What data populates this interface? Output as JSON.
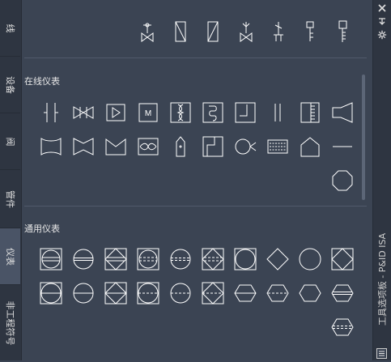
{
  "tabs": [
    {
      "id": "line",
      "label": "线"
    },
    {
      "id": "equipment",
      "label": "设备"
    },
    {
      "id": "valve",
      "label": "阀"
    },
    {
      "id": "fitting",
      "label": "管件"
    },
    {
      "id": "instrument",
      "label": "仪表",
      "active": true
    },
    {
      "id": "nonengineering",
      "label": "非工程符号"
    }
  ],
  "palette_title": "工具选项板 - P&ID ISA",
  "sections": {
    "inline": {
      "title": "在线仪表"
    },
    "general": {
      "title": "通用仪表"
    }
  },
  "colors": {
    "accent": "#ffffff",
    "background": "#3b4453",
    "strip": "#2e3541"
  },
  "icons": {
    "close": "close-icon",
    "autohide": "autohide-icon",
    "properties": "gear-icon",
    "palette_props": "palette-properties-icon"
  }
}
